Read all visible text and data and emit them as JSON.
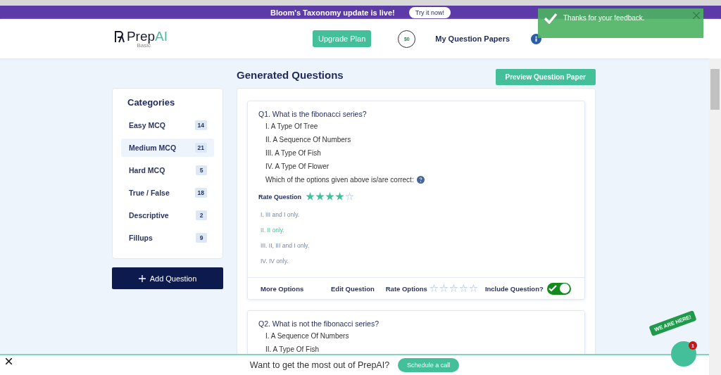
{
  "banner": {
    "text": "Bloom's Taxonomy update is live!",
    "button": "Try it now!"
  },
  "header": {
    "logo": {
      "prefix": "Prep",
      "accent": "AI"
    },
    "plan": "Basic",
    "upgrade": "Upgrade Plan",
    "coins": "$0",
    "nav": "My Question Papers"
  },
  "toast": {
    "message": "Thanks for your feedback."
  },
  "page_title": "Generated Questions",
  "preview_button": "Preview Question Paper",
  "categories": {
    "title": "Categories",
    "items": [
      {
        "label": "Easy MCQ",
        "count": "14",
        "selected": false
      },
      {
        "label": "Medium MCQ",
        "count": "21",
        "selected": true
      },
      {
        "label": "Hard MCQ",
        "count": "5",
        "selected": false
      },
      {
        "label": "True / False",
        "count": "18",
        "selected": false
      },
      {
        "label": "Descriptive",
        "count": "2",
        "selected": false
      },
      {
        "label": "Fillups",
        "count": "9",
        "selected": false
      }
    ]
  },
  "add_question": "Add Question",
  "questions": [
    {
      "question": "Q1. What is the fibonacci series?",
      "statements": [
        "I. A Type Of Tree",
        "II. A Sequence Of Numbers",
        "III. A Type Of Fish",
        "IV. A Type Of Flower"
      ],
      "prompt": "Which of the options given above is/are correct:",
      "rate_label": "Rate Question",
      "stars": 4,
      "options": [
        {
          "text": "I. III and I only.",
          "correct": false
        },
        {
          "text": "II. II only.",
          "correct": true
        },
        {
          "text": "III. II, III and I only.",
          "correct": false
        },
        {
          "text": "IV. IV only.",
          "correct": false
        }
      ],
      "footer": {
        "more": "More Options",
        "edit": "Edit Question",
        "rate": "Rate Options",
        "stars": 0,
        "include": "Include Question?",
        "on": true
      }
    },
    {
      "question": "Q2. What is not the fibonacci series?",
      "statements": [
        "I. A Sequence Of Numbers",
        "II. A Type Of Fish"
      ]
    }
  ],
  "bottom_bar": {
    "text": "Want to get the most out of PrepAI?",
    "button": "Schedule a call"
  },
  "chat": {
    "badge": "WE ARE HERE!",
    "count": "1"
  }
}
